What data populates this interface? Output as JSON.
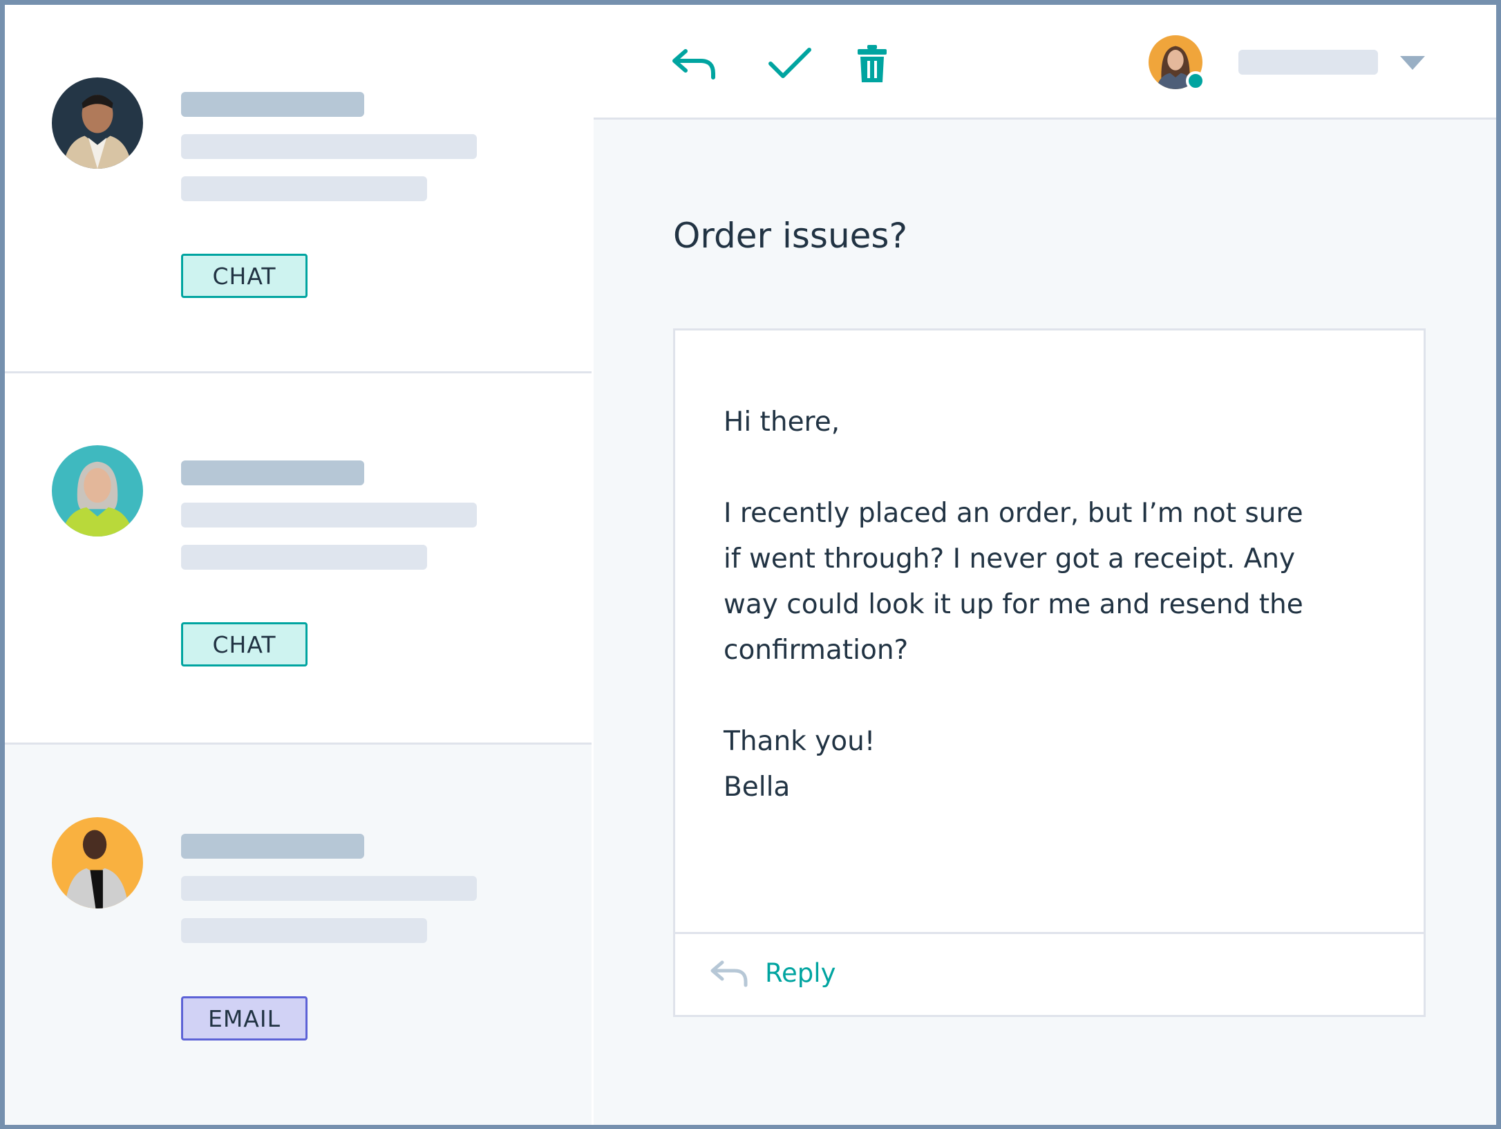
{
  "colors": {
    "accent": "#00a4a0",
    "frame": "#7590ae",
    "divider": "#dfe3eb",
    "skeleton_dark": "#b6c7d6",
    "skeleton_light": "#dfe5ee",
    "chat_badge_bg": "#cef3f0",
    "email_badge_bg": "#d1d2f5",
    "email_badge_border": "#5c62d6",
    "text": "#213343"
  },
  "conversations": [
    {
      "avatar": "avatar-man-dark-background",
      "channel": "CHAT",
      "selected": false
    },
    {
      "avatar": "avatar-woman-teal-background",
      "channel": "CHAT",
      "selected": false
    },
    {
      "avatar": "avatar-man-orange-background",
      "channel": "EMAIL",
      "selected": true
    }
  ],
  "toolbar": {
    "icons": [
      "reply-icon",
      "check-icon",
      "trash-icon"
    ],
    "agent_avatar": "agent-avatar",
    "agent_status": "online",
    "dropdown_icon": "caret-down-icon"
  },
  "thread": {
    "subject": "Order issues?",
    "message": {
      "greeting": "Hi there,",
      "body_lines": [
        "I recently placed an order, but I’m not sure",
        "if went through? I never got a receipt. Any",
        "way could look it up for me and resend the",
        "confirmation?"
      ],
      "closing": "Thank you!",
      "signature": "Bella"
    },
    "reply_label": "Reply"
  }
}
